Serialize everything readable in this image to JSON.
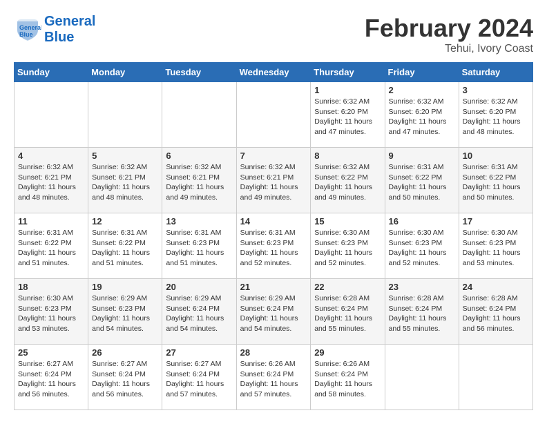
{
  "logo": {
    "line1": "General",
    "line2": "Blue"
  },
  "title": "February 2024",
  "subtitle": "Tehui, Ivory Coast",
  "days_of_week": [
    "Sunday",
    "Monday",
    "Tuesday",
    "Wednesday",
    "Thursday",
    "Friday",
    "Saturday"
  ],
  "weeks": [
    [
      {
        "day": "",
        "info": ""
      },
      {
        "day": "",
        "info": ""
      },
      {
        "day": "",
        "info": ""
      },
      {
        "day": "",
        "info": ""
      },
      {
        "day": "1",
        "info": "Sunrise: 6:32 AM\nSunset: 6:20 PM\nDaylight: 11 hours\nand 47 minutes."
      },
      {
        "day": "2",
        "info": "Sunrise: 6:32 AM\nSunset: 6:20 PM\nDaylight: 11 hours\nand 47 minutes."
      },
      {
        "day": "3",
        "info": "Sunrise: 6:32 AM\nSunset: 6:20 PM\nDaylight: 11 hours\nand 48 minutes."
      }
    ],
    [
      {
        "day": "4",
        "info": "Sunrise: 6:32 AM\nSunset: 6:21 PM\nDaylight: 11 hours\nand 48 minutes."
      },
      {
        "day": "5",
        "info": "Sunrise: 6:32 AM\nSunset: 6:21 PM\nDaylight: 11 hours\nand 48 minutes."
      },
      {
        "day": "6",
        "info": "Sunrise: 6:32 AM\nSunset: 6:21 PM\nDaylight: 11 hours\nand 49 minutes."
      },
      {
        "day": "7",
        "info": "Sunrise: 6:32 AM\nSunset: 6:21 PM\nDaylight: 11 hours\nand 49 minutes."
      },
      {
        "day": "8",
        "info": "Sunrise: 6:32 AM\nSunset: 6:22 PM\nDaylight: 11 hours\nand 49 minutes."
      },
      {
        "day": "9",
        "info": "Sunrise: 6:31 AM\nSunset: 6:22 PM\nDaylight: 11 hours\nand 50 minutes."
      },
      {
        "day": "10",
        "info": "Sunrise: 6:31 AM\nSunset: 6:22 PM\nDaylight: 11 hours\nand 50 minutes."
      }
    ],
    [
      {
        "day": "11",
        "info": "Sunrise: 6:31 AM\nSunset: 6:22 PM\nDaylight: 11 hours\nand 51 minutes."
      },
      {
        "day": "12",
        "info": "Sunrise: 6:31 AM\nSunset: 6:22 PM\nDaylight: 11 hours\nand 51 minutes."
      },
      {
        "day": "13",
        "info": "Sunrise: 6:31 AM\nSunset: 6:23 PM\nDaylight: 11 hours\nand 51 minutes."
      },
      {
        "day": "14",
        "info": "Sunrise: 6:31 AM\nSunset: 6:23 PM\nDaylight: 11 hours\nand 52 minutes."
      },
      {
        "day": "15",
        "info": "Sunrise: 6:30 AM\nSunset: 6:23 PM\nDaylight: 11 hours\nand 52 minutes."
      },
      {
        "day": "16",
        "info": "Sunrise: 6:30 AM\nSunset: 6:23 PM\nDaylight: 11 hours\nand 52 minutes."
      },
      {
        "day": "17",
        "info": "Sunrise: 6:30 AM\nSunset: 6:23 PM\nDaylight: 11 hours\nand 53 minutes."
      }
    ],
    [
      {
        "day": "18",
        "info": "Sunrise: 6:30 AM\nSunset: 6:23 PM\nDaylight: 11 hours\nand 53 minutes."
      },
      {
        "day": "19",
        "info": "Sunrise: 6:29 AM\nSunset: 6:23 PM\nDaylight: 11 hours\nand 54 minutes."
      },
      {
        "day": "20",
        "info": "Sunrise: 6:29 AM\nSunset: 6:24 PM\nDaylight: 11 hours\nand 54 minutes."
      },
      {
        "day": "21",
        "info": "Sunrise: 6:29 AM\nSunset: 6:24 PM\nDaylight: 11 hours\nand 54 minutes."
      },
      {
        "day": "22",
        "info": "Sunrise: 6:28 AM\nSunset: 6:24 PM\nDaylight: 11 hours\nand 55 minutes."
      },
      {
        "day": "23",
        "info": "Sunrise: 6:28 AM\nSunset: 6:24 PM\nDaylight: 11 hours\nand 55 minutes."
      },
      {
        "day": "24",
        "info": "Sunrise: 6:28 AM\nSunset: 6:24 PM\nDaylight: 11 hours\nand 56 minutes."
      }
    ],
    [
      {
        "day": "25",
        "info": "Sunrise: 6:27 AM\nSunset: 6:24 PM\nDaylight: 11 hours\nand 56 minutes."
      },
      {
        "day": "26",
        "info": "Sunrise: 6:27 AM\nSunset: 6:24 PM\nDaylight: 11 hours\nand 56 minutes."
      },
      {
        "day": "27",
        "info": "Sunrise: 6:27 AM\nSunset: 6:24 PM\nDaylight: 11 hours\nand 57 minutes."
      },
      {
        "day": "28",
        "info": "Sunrise: 6:26 AM\nSunset: 6:24 PM\nDaylight: 11 hours\nand 57 minutes."
      },
      {
        "day": "29",
        "info": "Sunrise: 6:26 AM\nSunset: 6:24 PM\nDaylight: 11 hours\nand 58 minutes."
      },
      {
        "day": "",
        "info": ""
      },
      {
        "day": "",
        "info": ""
      }
    ]
  ]
}
